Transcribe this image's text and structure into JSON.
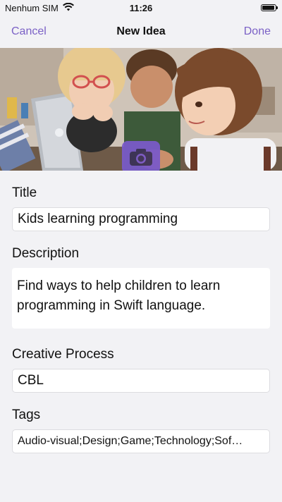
{
  "status_bar": {
    "carrier": "Nenhum SIM",
    "time": "11:26",
    "battery_level": 0.95
  },
  "nav": {
    "cancel_label": "Cancel",
    "title": "New Idea",
    "done_label": "Done"
  },
  "hero": {
    "camera_icon": "camera-icon"
  },
  "form": {
    "title_label": "Title",
    "title_value": "Kids learning programming",
    "description_label": "Description",
    "description_value": "Find ways to help children to learn programming in Swift language.",
    "process_label": "Creative Process",
    "process_value": "CBL",
    "tags_label": "Tags",
    "tags_value": "Audio-visual;Design;Game;Technology;Sof…"
  },
  "colors": {
    "accent": "#7b61c6",
    "camera_bg": "#7a5ac8",
    "background": "#f2f2f5"
  }
}
